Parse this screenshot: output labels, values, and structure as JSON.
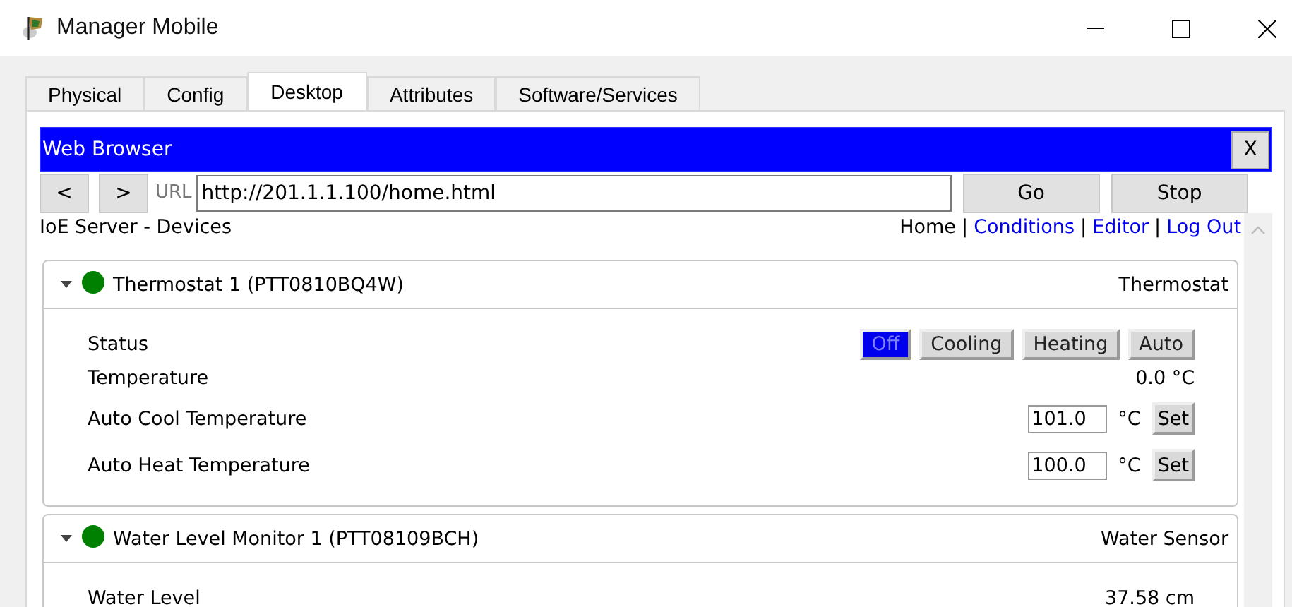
{
  "window": {
    "title": "Manager Mobile"
  },
  "tabs": [
    {
      "label": "Physical",
      "selected": false
    },
    {
      "label": "Config",
      "selected": false
    },
    {
      "label": "Desktop",
      "selected": true
    },
    {
      "label": "Attributes",
      "selected": false
    },
    {
      "label": "Software/Services",
      "selected": false
    }
  ],
  "browser": {
    "title": "Web Browser",
    "close": "X",
    "back": "<",
    "forward": ">",
    "url_label": "URL",
    "url": "http://201.1.1.100/home.html",
    "go": "Go",
    "stop": "Stop"
  },
  "page": {
    "heading": "IoE Server - Devices",
    "separator": "|",
    "nav": [
      {
        "label": "Home",
        "kind": "current"
      },
      {
        "label": "Conditions",
        "kind": "link"
      },
      {
        "label": "Editor",
        "kind": "link"
      },
      {
        "label": "Log Out",
        "kind": "link"
      }
    ],
    "devices": [
      {
        "name": "Thermostat 1 (PTT0810BQ4W)",
        "type": "Thermostat",
        "color": "#008000",
        "expanded": true,
        "rows": [
          {
            "kind": "modes",
            "label": "Status",
            "modes": [
              {
                "label": "Off",
                "selected": true
              },
              {
                "label": "Cooling",
                "selected": false
              },
              {
                "label": "Heating",
                "selected": false
              },
              {
                "label": "Auto",
                "selected": false
              }
            ]
          },
          {
            "kind": "reading",
            "label": "Temperature",
            "value": "0.0 °C"
          },
          {
            "kind": "setpoint",
            "label": "Auto Cool Temperature",
            "value": "101.0",
            "unit": "°C",
            "button": "Set"
          },
          {
            "kind": "setpoint",
            "label": "Auto Heat Temperature",
            "value": "100.0",
            "unit": "°C",
            "button": "Set"
          }
        ]
      },
      {
        "name": "Water Level Monitor 1 (PTT08109BCH)",
        "type": "Water Sensor",
        "color": "#008000",
        "expanded": true,
        "rows": [
          {
            "kind": "reading",
            "label": "Water Level",
            "value": "37.58 cm"
          }
        ]
      }
    ]
  }
}
